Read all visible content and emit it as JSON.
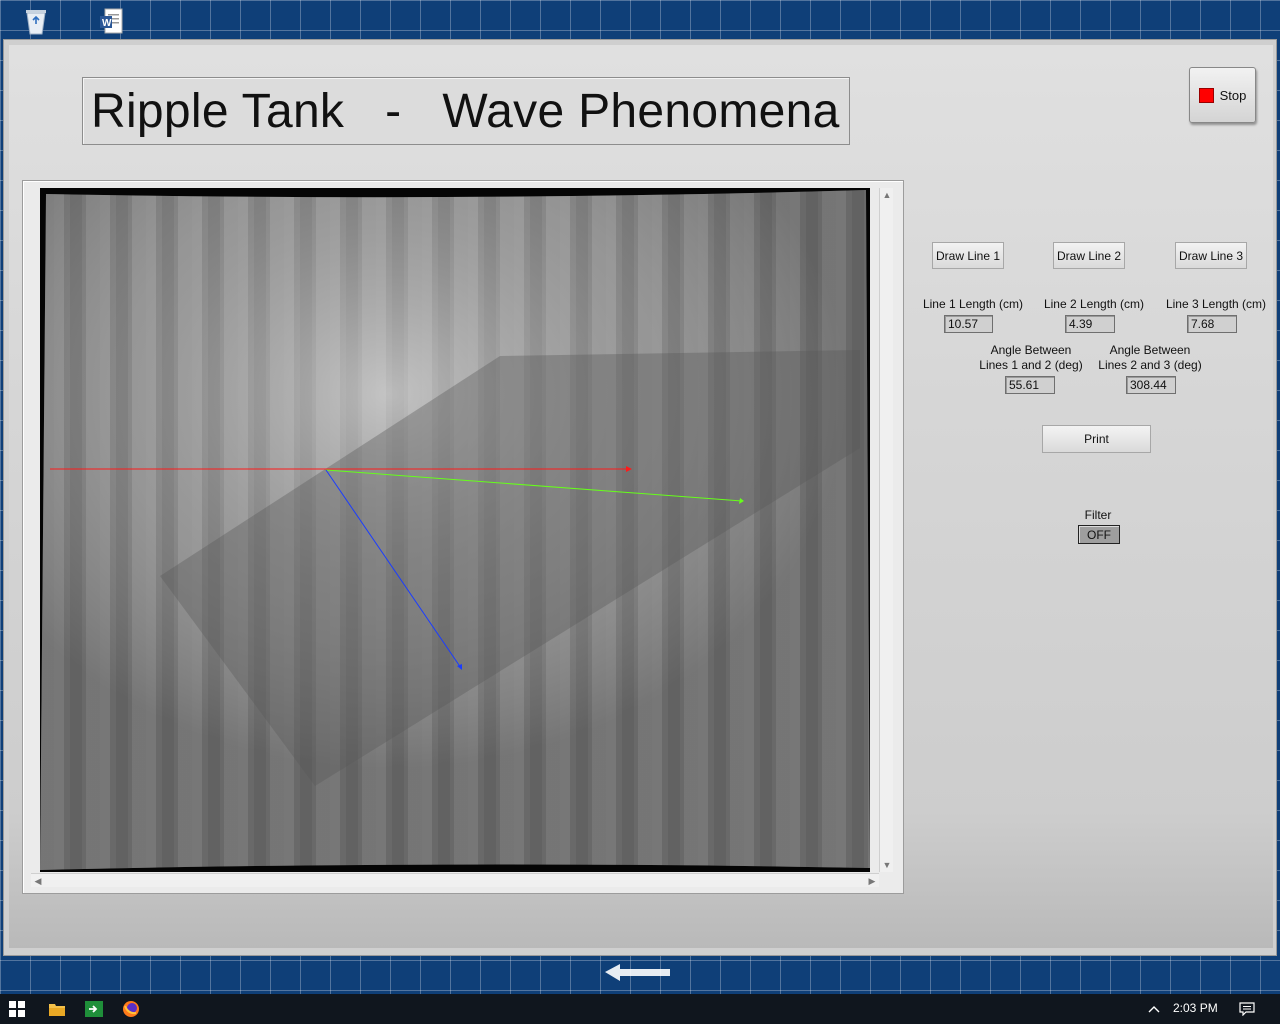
{
  "desktop": {
    "icons": [
      {
        "name": "recycle-bin-icon"
      },
      {
        "name": "word-document-icon"
      }
    ]
  },
  "app": {
    "title": "Ripple Tank   -   Wave Phenomena",
    "stop_button": {
      "label": "Stop",
      "color": "#ff0000"
    },
    "buttons": {
      "draw_line_1": "Draw Line 1",
      "draw_line_2": "Draw Line 2",
      "draw_line_3": "Draw Line 3",
      "print": "Print"
    },
    "measurements": {
      "line1_label": "Line 1 Length (cm)",
      "line1_value": "10.57",
      "line2_label": "Line 2 Length (cm)",
      "line2_value": "4.39",
      "line3_label": "Line 3 Length (cm)",
      "line3_value": "7.68",
      "angle12_label_1": "Angle Between",
      "angle12_label_2": "Lines 1 and 2 (deg)",
      "angle12_value": "55.61",
      "angle23_label_1": "Angle Between",
      "angle23_label_2": "Lines 2 and 3 (deg)",
      "angle23_value": "308.44"
    },
    "filter": {
      "label": "Filter",
      "state": "OFF"
    },
    "line_colors": {
      "line1": "#ff1a1a",
      "line2": "#66ff1a",
      "line3": "#1a3cff"
    }
  },
  "taskbar": {
    "time": "2:03 PM",
    "icons": [
      "windows-start-icon",
      "file-explorer-icon",
      "labview-icon",
      "firefox-icon"
    ]
  }
}
